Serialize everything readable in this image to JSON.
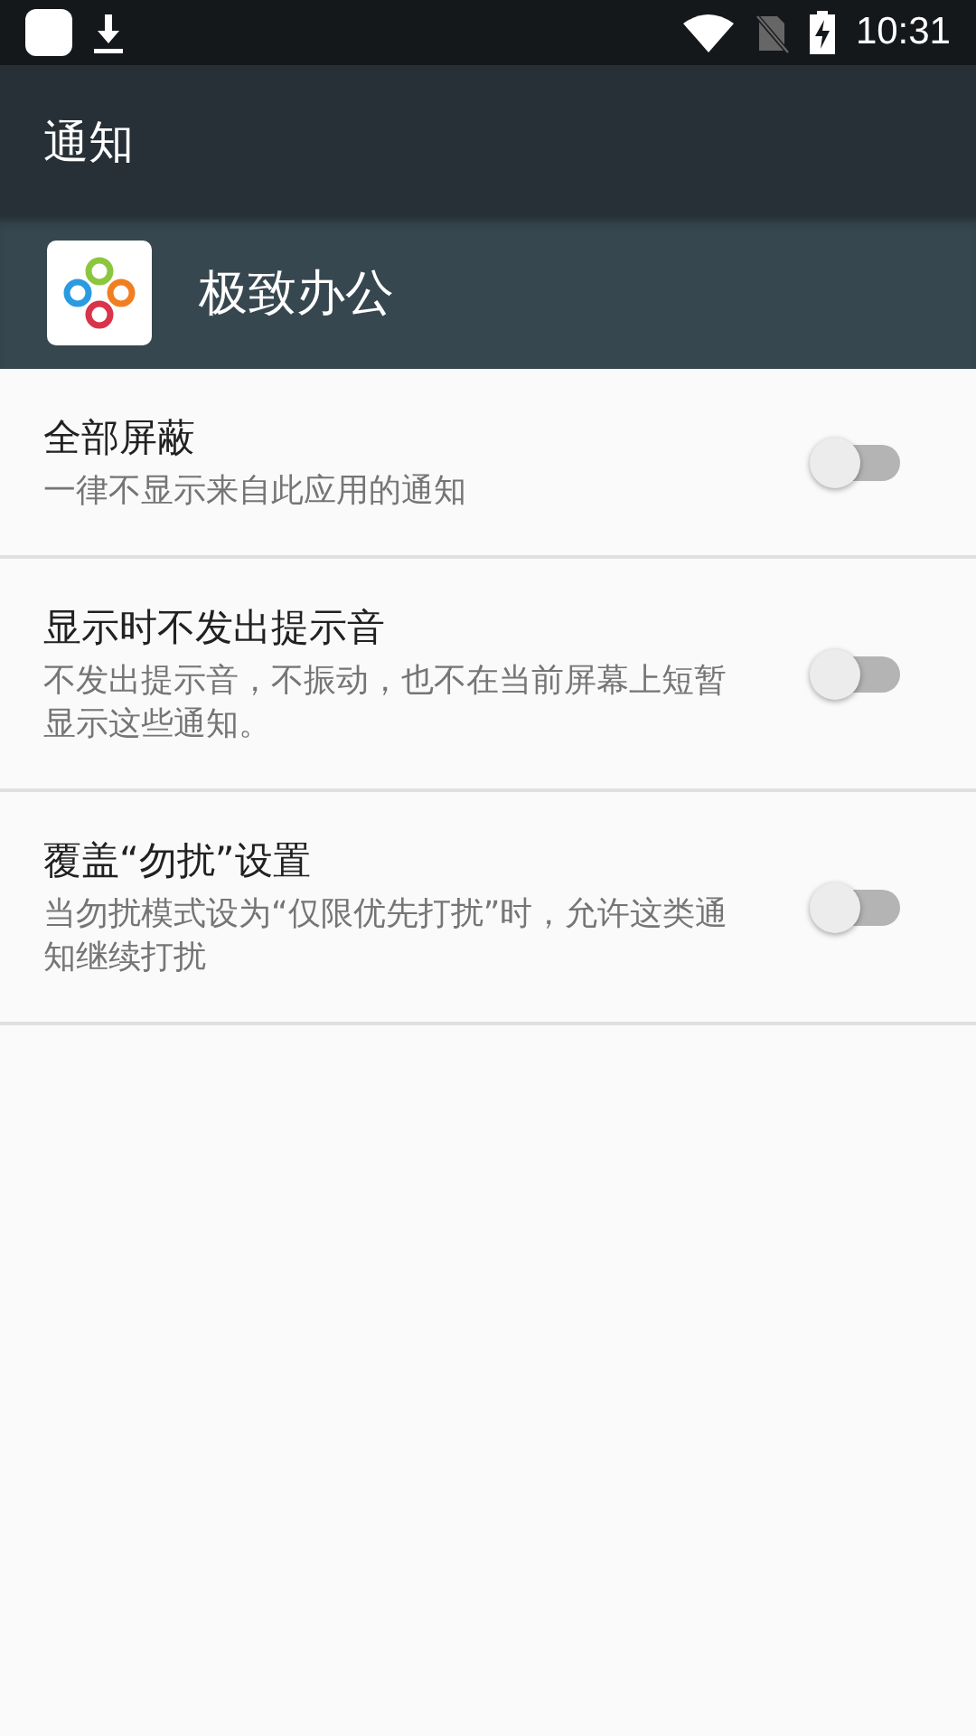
{
  "status_bar": {
    "time": "10:31"
  },
  "app_bar": {
    "title": "通知"
  },
  "app_header": {
    "name": "极致办公"
  },
  "settings": [
    {
      "title": "全部屏蔽",
      "summary": "一律不显示来自此应用的通知",
      "on": false
    },
    {
      "title": "显示时不发出提示音",
      "summary": "不发出提示音，不振动，也不在当前屏幕上短暂显示这些通知。",
      "on": false
    },
    {
      "title": "覆盖“勿扰”设置",
      "summary": "当勿扰模式设为“仅限优先打扰”时，允许这类通知继续打扰",
      "on": false
    }
  ]
}
